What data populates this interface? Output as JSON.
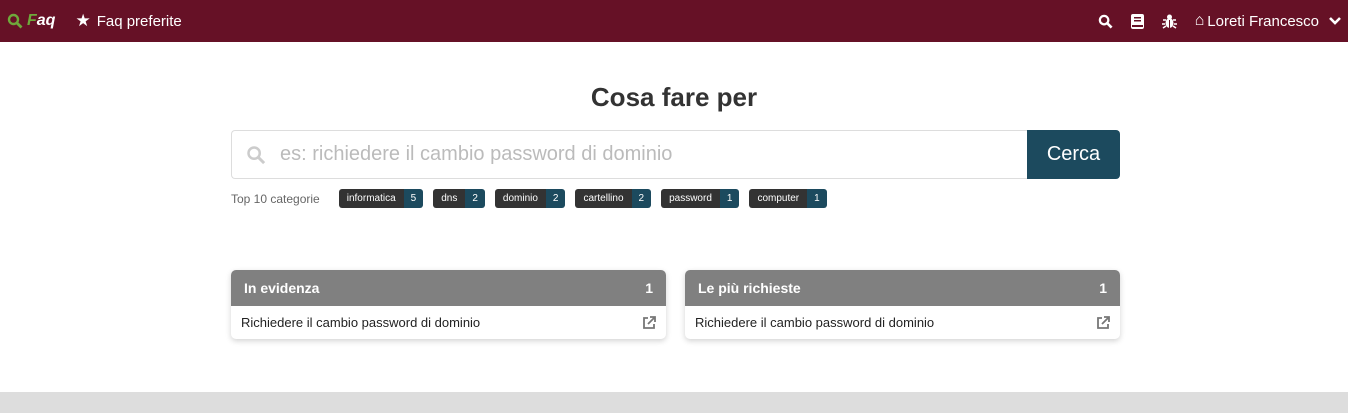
{
  "nav": {
    "brand": "Faq",
    "brand_first": "F",
    "brand_rest": "aq",
    "favorites": "Faq preferite",
    "user": "Loreti Francesco"
  },
  "main": {
    "title": "Cosa fare per",
    "search_placeholder": "es: richiedere il cambio password di dominio",
    "search_button": "Cerca",
    "top_label": "Top 10 categorie",
    "categories": [
      {
        "name": "informatica",
        "count": "5"
      },
      {
        "name": "dns",
        "count": "2"
      },
      {
        "name": "dominio",
        "count": "2"
      },
      {
        "name": "cartellino",
        "count": "2"
      },
      {
        "name": "password",
        "count": "1"
      },
      {
        "name": "computer",
        "count": "1"
      }
    ]
  },
  "panels": [
    {
      "title": "In evidenza",
      "count": "1",
      "items": [
        "Richiedere il cambio password di dominio"
      ]
    },
    {
      "title": "Le più richieste",
      "count": "1",
      "items": [
        "Richiedere il cambio password di dominio"
      ]
    }
  ]
}
